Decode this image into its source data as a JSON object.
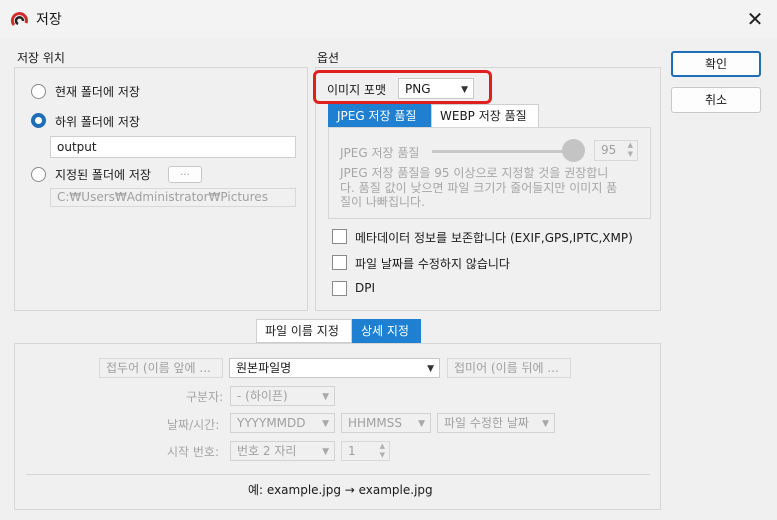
{
  "window": {
    "title": "저장",
    "close_icon": "close-icon"
  },
  "location": {
    "title": "저장 위치",
    "options": [
      {
        "label": "현재 폴더에 저장",
        "selected": false
      },
      {
        "label": "하위 폴더에 저장",
        "selected": true
      },
      {
        "label": "지정된 폴더에 저장",
        "selected": false
      }
    ],
    "subfolder_value": "output",
    "browse_label": "...",
    "folder_path": "C:₩Users₩Administrator₩Pictures"
  },
  "options": {
    "title": "옵션",
    "format_label": "이미지 포맷",
    "format_value": "PNG",
    "tabs": [
      {
        "label": "JPEG 저장 품질",
        "active": true
      },
      {
        "label": "WEBP 저장 품질",
        "active": false
      }
    ],
    "quality_label": "JPEG 저장 품질",
    "quality_value": "95",
    "quality_hint_1": "JPEG 저장 품질을 95 이상으로 지정할 것을 권장합니",
    "quality_hint_2": "다. 품질 값이 낮으면 파일 크기가 줄어들지만 이미지 품",
    "quality_hint_3": "질이 나빠집니다.",
    "checkboxes": [
      {
        "label": "메타데이터 정보를 보존합니다 (EXIF,GPS,IPTC,XMP)",
        "checked": false
      },
      {
        "label": "파일 날짜를 수정하지 않습니다",
        "checked": false
      },
      {
        "label": "DPI",
        "checked": false
      }
    ]
  },
  "actions": {
    "ok_label": "확인",
    "cancel_label": "취소"
  },
  "naming": {
    "tabs": [
      {
        "label": "파일 이름 지정",
        "active": false
      },
      {
        "label": "상세 지정",
        "active": true
      }
    ],
    "prefix_placeholder": "접두어 (이름 앞에 ...",
    "base_name": "원본파일명",
    "suffix_placeholder": "접미어 (이름 뒤에 ...",
    "separator_label": "구분자:",
    "separator_value": "- (하이픈)",
    "datetime_label": "날짜/시간:",
    "date_format": "YYYYMMDD",
    "time_format": "HHMMSS",
    "date_source": "파일 수정한 날짜",
    "start_number_label": "시작 번호:",
    "digits_value": "번호 2 자리",
    "start_value": "1",
    "example_text": "예: example.jpg → example.jpg"
  }
}
